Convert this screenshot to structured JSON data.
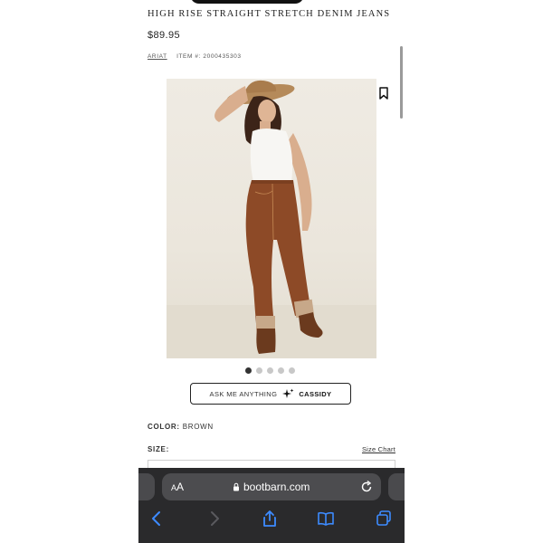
{
  "product": {
    "title": "HIGH RISE STRAIGHT STRETCH DENIM JEANS",
    "price": "$89.95",
    "brand": "ARIAT",
    "item_number": "ITEM #: 2000435303"
  },
  "gallery": {
    "image_icon": "product-photo",
    "bookmark_icon": "bookmark-icon",
    "dots_total": 5,
    "active_index": 0
  },
  "assistant": {
    "prefix": "ASK ME ANYTHING",
    "icon": "sparkle-icon",
    "name": "CASSIDY"
  },
  "color": {
    "label": "COLOR:",
    "value": "BROWN"
  },
  "size": {
    "label": "SIZE:",
    "chart_link": "Size Chart"
  },
  "browser": {
    "text_size": "AA",
    "host": "bootbarn.com",
    "colors": {
      "toolbar_bg": "#2a2a2c",
      "accent": "#3d8bff"
    }
  }
}
